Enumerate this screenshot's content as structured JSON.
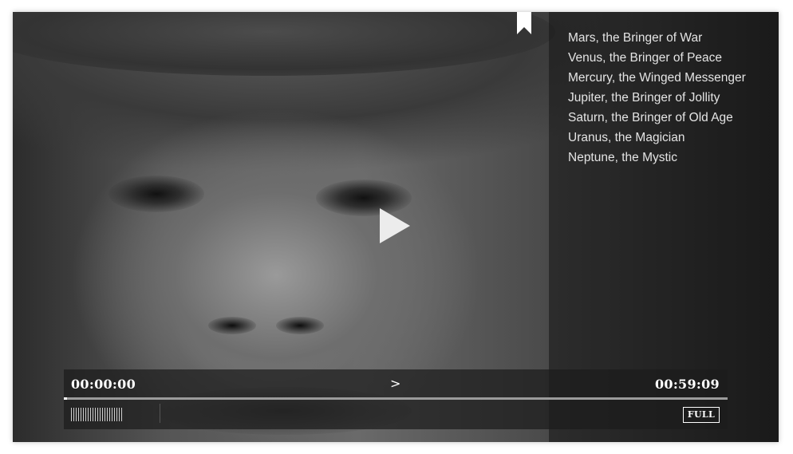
{
  "playlist": {
    "items": [
      "Mars, the Bringer of War",
      "Venus, the Bringer of Peace",
      "Mercury, the Winged Messenger",
      "Jupiter, the Bringer of Jollity",
      "Saturn, the Bringer of Old Age",
      "Uranus, the Magician",
      "Neptune, the Mystic"
    ]
  },
  "controls": {
    "current_time": "00:00:00",
    "next_label": ">",
    "total_time": "00:59:09",
    "full_label": "FULL",
    "progress": 0.0
  },
  "icons": {
    "play": "play-icon",
    "bookmark": "bookmark-icon",
    "volume": "volume-bars-icon"
  },
  "colors": {
    "text": "#ffffff",
    "playlist_text": "#e4e4e4",
    "track": "#9b9b9b"
  }
}
